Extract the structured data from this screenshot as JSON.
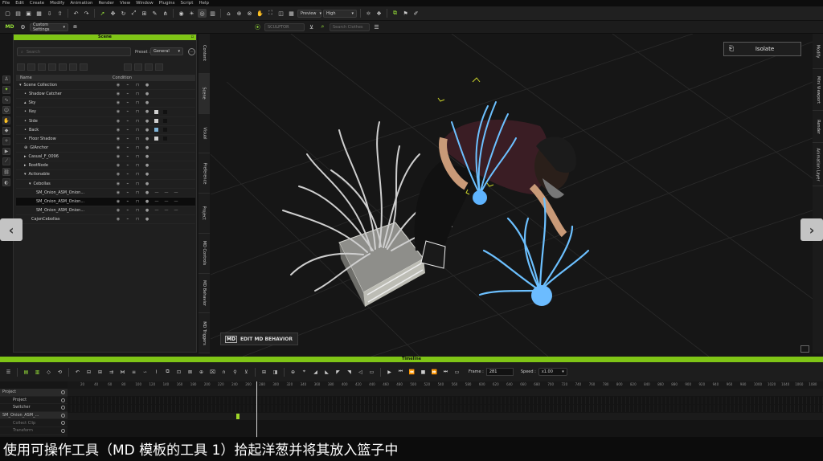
{
  "menubar": [
    "File",
    "Edit",
    "Create",
    "Modify",
    "Animation",
    "Render",
    "View",
    "Window",
    "Plugins",
    "Script",
    "Help"
  ],
  "toolbar": {
    "preview_dropdown": "Preview",
    "quality_dropdown": "High",
    "custom_settings": "Custom Settings",
    "sculpt_label": "SCULPTOR",
    "search_placeholder": "Search Clothes"
  },
  "scene_panel": {
    "title": "Scene",
    "search_placeholder": "Search",
    "preset_label": "Preset :",
    "preset_value": "General",
    "columns": [
      "Name",
      "Condition"
    ],
    "items": [
      {
        "name": "Scene Collection",
        "indent": 0,
        "prefix": "▾"
      },
      {
        "name": "Shadow Catcher",
        "indent": 1,
        "prefix": "•"
      },
      {
        "name": "Sky",
        "indent": 1,
        "prefix": "▴"
      },
      {
        "name": "Key",
        "indent": 1,
        "prefix": "•"
      },
      {
        "name": "Side",
        "indent": 1,
        "prefix": "•"
      },
      {
        "name": "Back",
        "indent": 1,
        "prefix": "•"
      },
      {
        "name": "Floor Shadow",
        "indent": 1,
        "prefix": "•"
      },
      {
        "name": "GIAnchor",
        "indent": 1,
        "prefix": "⊕"
      },
      {
        "name": "Casual_F_0096",
        "indent": 1,
        "prefix": "▸"
      },
      {
        "name": "RootNode",
        "indent": 1,
        "prefix": "▸"
      },
      {
        "name": "Actionable",
        "indent": 1,
        "prefix": "▾"
      },
      {
        "name": "Cebollas",
        "indent": 2,
        "prefix": "▾"
      },
      {
        "name": "SM_Onion_ASM_Onion...",
        "indent": 3,
        "prefix": ""
      },
      {
        "name": "SM_Onion_ASM_Onion...",
        "indent": 3,
        "prefix": "",
        "selected": true
      },
      {
        "name": "SM_Onion_ASM_Onion...",
        "indent": 3,
        "prefix": ""
      },
      {
        "name": "CajonCebollas",
        "indent": 2,
        "prefix": ""
      }
    ]
  },
  "side_tabs": [
    "Content",
    "Scene",
    "Visual",
    "Preference",
    "Project",
    "MD Controls",
    "MD Behavior",
    "MD Triggers"
  ],
  "right_tabs": [
    "Modify",
    "Mini Viewport",
    "Render",
    "Animation Layer"
  ],
  "viewport": {
    "isolate_label": "Isolate",
    "edit_md_label": "EDIT MD BEHAVIOR",
    "md_logo": "MD"
  },
  "timeline": {
    "title": "Timeline",
    "frame_label": "Frame :",
    "frame_value": "281",
    "speed_label": "Speed :",
    "speed_value": "x1.00",
    "ruler_ticks": [
      "20",
      "40",
      "60",
      "80",
      "100",
      "120",
      "140",
      "160",
      "180",
      "200",
      "220",
      "240",
      "260",
      "280",
      "300",
      "320",
      "340",
      "360",
      "380",
      "400",
      "420",
      "440",
      "460",
      "480",
      "500",
      "520",
      "540",
      "560",
      "580",
      "600",
      "620",
      "640",
      "660",
      "680",
      "700",
      "720",
      "740",
      "760",
      "780",
      "800",
      "820",
      "840",
      "860",
      "880",
      "900",
      "920",
      "940",
      "960",
      "980",
      "1000",
      "1020",
      "1040",
      "1060",
      "1080"
    ],
    "tracks": [
      "Project",
      "Project",
      "Switcher",
      "SM_Onion_ASM_...",
      "Collect Clip",
      "Transform"
    ]
  },
  "subtitle": "使用可操作工具（MD 模板的工具 1）拾起洋葱并将其放入篮子中",
  "colors": {
    "accent": "#7fc516",
    "glow": "#55aaff",
    "bg": "#161616"
  }
}
